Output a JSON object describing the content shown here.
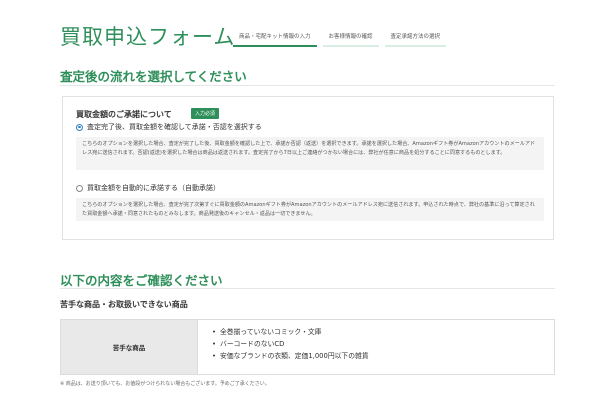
{
  "header": {
    "title": "買取申込フォーム",
    "steps": [
      "商品・宅配キット情報の入力",
      "お客様情報の確認",
      "査定承諾方法の選択"
    ]
  },
  "section1": {
    "title": "査定後の流れを選択してください",
    "question": "買取金額のご承諾について",
    "required_badge": "入力必須",
    "options": [
      {
        "label": "査定完了後、買取金額を確認して承諾・否認を選択する",
        "selected": true,
        "description": "こちらのオプションを選択した場合、査定が完了した後、買取金額を確認した上で、承諾か否認（返送）を選択できます。承諾を選択した場合、Amazonギフト券がAmazonアカウントのメールアドレス宛に送信されます。否認(返送)を選択した場合は商品は返送されます。査定完了から7日以上ご連絡がつかない場合には、弊社が任意に商品を処分することに同意するものとします。"
      },
      {
        "label": "買取金額を自動的に承諾する（自動承諾）",
        "selected": false,
        "description": "こちらのオプションを選択した場合、査定が完了次第すぐに買取金額のAmazonギフト券がAmazonアカウントのメールアドレス宛に送信されます。申込された時点で、弊社の基準に沿って算定された買取金額へ承諾・同意されたものとみなします。商品発送後のキャンセル・返品は一切できません。"
      }
    ]
  },
  "section2": {
    "title": "以下の内容をご確認ください",
    "subtitle": "苦手な商品・お取扱いできない商品",
    "table": {
      "header": "苦手な商品",
      "items": [
        "全巻揃っていないコミック・文庫",
        "バーコードのないCD",
        "安価なブランドの衣類、定価1,000円以下の雑貨"
      ]
    },
    "note": "※ 商品は、お送り頂いても、お値段がつけられない場合もございます。予めご了承ください。"
  },
  "colors": {
    "accent": "#2f8f5b",
    "radio_selected": "#2f7fc1"
  }
}
